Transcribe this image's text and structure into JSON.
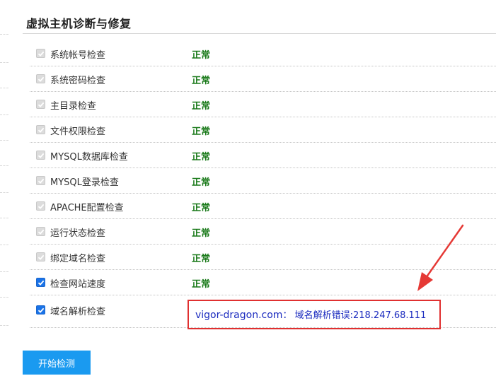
{
  "panel": {
    "title": "虚拟主机诊断与修复"
  },
  "checks": [
    {
      "label": "系统帐号检查",
      "status": "正常",
      "state": "disabled"
    },
    {
      "label": "系统密码检查",
      "status": "正常",
      "state": "disabled"
    },
    {
      "label": "主目录检查",
      "status": "正常",
      "state": "disabled"
    },
    {
      "label": "文件权限检查",
      "status": "正常",
      "state": "disabled"
    },
    {
      "label": "MYSQL数据库检查",
      "status": "正常",
      "state": "disabled"
    },
    {
      "label": "MYSQL登录检查",
      "status": "正常",
      "state": "disabled"
    },
    {
      "label": "APACHE配置检查",
      "status": "正常",
      "state": "disabled"
    },
    {
      "label": "运行状态检查",
      "status": "正常",
      "state": "disabled"
    },
    {
      "label": "绑定域名检查",
      "status": "正常",
      "state": "disabled"
    },
    {
      "label": "检查网站速度",
      "status": "正常",
      "state": "checked"
    }
  ],
  "dns_check": {
    "label": "域名解析检查",
    "domain": "vigor-dragon.com",
    "separator": "：",
    "message": "域名解析错误:218.247.68.111"
  },
  "actions": {
    "start_label": "开始检测"
  },
  "colors": {
    "ok": "#1a7a1a",
    "error_border": "#e03030",
    "error_text": "#1b2bbf",
    "button": "#1a9af0",
    "arrow": "#e53935"
  }
}
